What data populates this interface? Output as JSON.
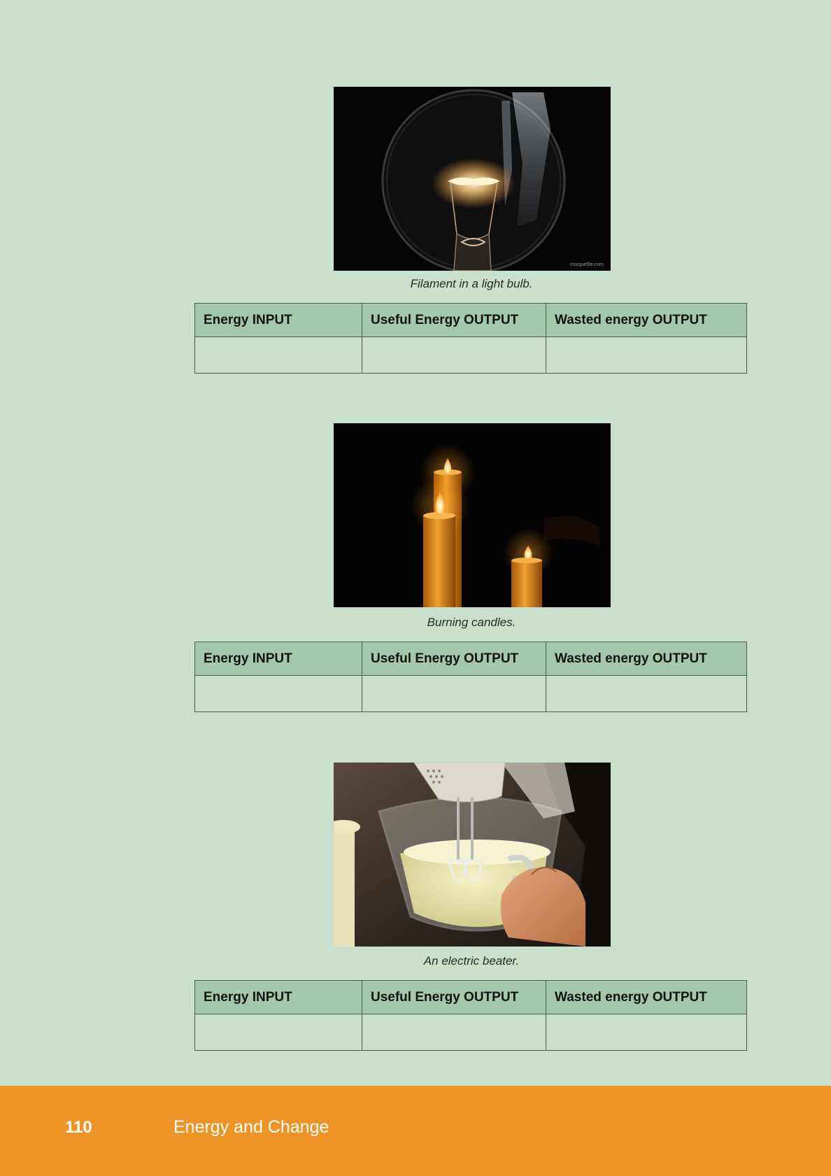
{
  "items": [
    {
      "image": "light-bulb-filament-photo",
      "watermark": "morguefile.com",
      "caption": "Filament in a light bulb.",
      "table": {
        "headers": [
          "Energy INPUT",
          "Useful Energy OUTPUT",
          "Wasted energy OUTPUT"
        ],
        "row": [
          "",
          "",
          ""
        ]
      }
    },
    {
      "image": "burning-candles-photo",
      "caption": "Burning candles.",
      "table": {
        "headers": [
          "Energy INPUT",
          "Useful Energy OUTPUT",
          "Wasted energy OUTPUT"
        ],
        "row": [
          "",
          "",
          ""
        ]
      }
    },
    {
      "image": "electric-beater-photo",
      "caption": "An electric beater.",
      "table": {
        "headers": [
          "Energy INPUT",
          "Useful Energy OUTPUT",
          "Wasted energy OUTPUT"
        ],
        "row": [
          "",
          "",
          ""
        ]
      }
    }
  ],
  "footer": {
    "page_number": "110",
    "chapter_title": "Energy and Change",
    "color": "#ee9426"
  },
  "colors": {
    "background": "#c8e0cc",
    "table_header": "#a3c8ad"
  }
}
